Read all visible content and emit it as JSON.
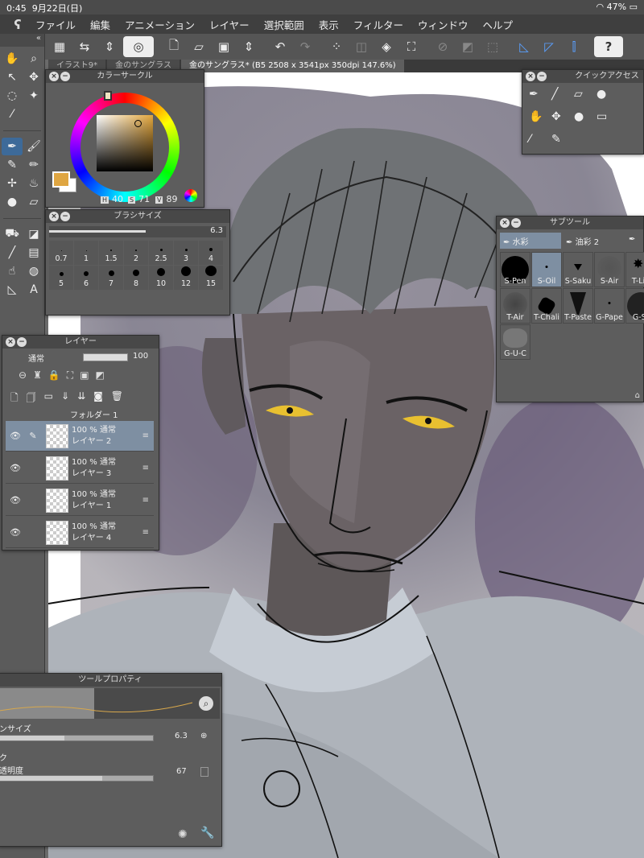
{
  "status": {
    "time": "0:45",
    "date": "9月22日(日)",
    "battery": "47%"
  },
  "menubar": [
    "ファイル",
    "編集",
    "アニメーション",
    "レイヤー",
    "選択範囲",
    "表示",
    "フィルター",
    "ウィンドウ",
    "ヘルプ"
  ],
  "doctabs": [
    "イラスト9*",
    "金のサングラス",
    "金のサングラス* (B5 2508 x 3541px 350dpi 147.6%)"
  ],
  "color_circle": {
    "title": "カラーサークル",
    "h_label": "H",
    "h": "40",
    "s_label": "S",
    "s": "71",
    "v_label": "V",
    "v": "89",
    "main_color": "#dfa642"
  },
  "brush_size": {
    "title": "ブラシサイズ",
    "value": "6.3",
    "sizes": [
      "0.7",
      "1",
      "1.5",
      "2",
      "2.5",
      "3",
      "4",
      "5",
      "6",
      "7",
      "8",
      "10",
      "12",
      "15"
    ]
  },
  "quick_access": {
    "title": "クイックアクセス"
  },
  "subtool": {
    "title": "サブツール",
    "tab1": "水彩",
    "tab2": "油彩 2",
    "items": [
      "S-Pen",
      "S-Oil",
      "S-Saku",
      "S-Air",
      "T-Lin",
      "T-Air",
      "T-Chali",
      "T-Paste",
      "G-Pape",
      "G-S-",
      "G-U-C"
    ]
  },
  "layer": {
    "title": "レイヤー",
    "blend": "通常",
    "opacity": "100",
    "folder": "フォルダー 1",
    "rows": [
      {
        "mode": "100 % 通常",
        "name": "レイヤー 2"
      },
      {
        "mode": "100 % 通常",
        "name": "レイヤー 3"
      },
      {
        "mode": "100 % 通常",
        "name": "レイヤー 1"
      },
      {
        "mode": "100 % 通常",
        "name": "レイヤー 4"
      }
    ]
  },
  "tool_property": {
    "title": "ツールプロパティ",
    "size_label": "ンサイズ",
    "size_value": "6.3",
    "section": "ク",
    "opacity_label": "透明度",
    "opacity_value": "67",
    "size_fill": 0.42,
    "opacity_fill": 0.67
  }
}
